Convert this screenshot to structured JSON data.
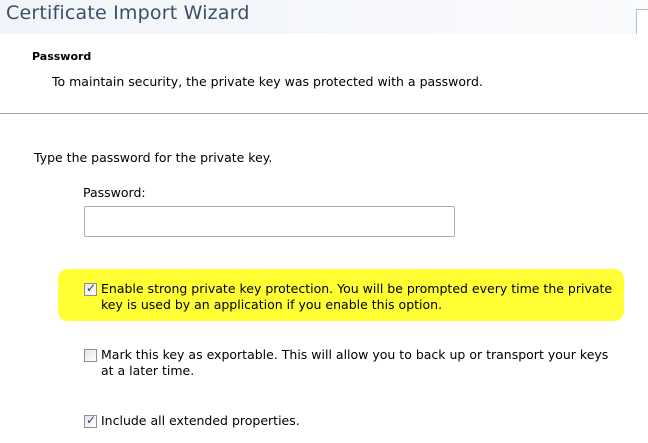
{
  "window": {
    "title": "Certificate Import Wizard"
  },
  "header": {
    "title": "Password",
    "subtitle": "To maintain security, the private key was protected with a password."
  },
  "body": {
    "instruction": "Type the password for the private key.",
    "password_label": "Password:",
    "password_value": ""
  },
  "options": [
    {
      "label": "Enable strong private key protection. You will be prompted every time the private key is used by an application if you enable this option.",
      "checked": true,
      "highlighted": true
    },
    {
      "label": "Mark this key as exportable. This will allow you to back up or transport your keys at a later time.",
      "checked": false,
      "highlighted": false
    },
    {
      "label": "Include all extended properties.",
      "checked": true,
      "highlighted": false
    }
  ],
  "colors": {
    "highlight": "#ffff33",
    "title_text": "#3a4f66",
    "check_mark": "#2a3f78"
  }
}
